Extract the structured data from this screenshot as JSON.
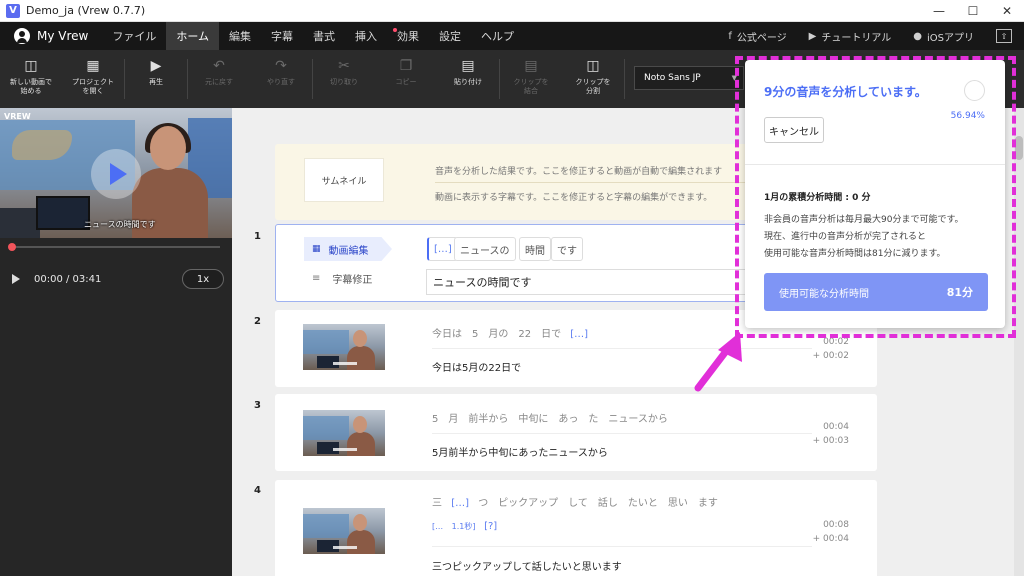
{
  "window": {
    "title": "Demo_ja (Vrew 0.7.7)",
    "logo": "V"
  },
  "menubar": {
    "user": "My Vrew",
    "items": [
      "ファイル",
      "ホーム",
      "編集",
      "字幕",
      "書式",
      "挿入",
      "効果",
      "設定",
      "ヘルプ"
    ],
    "active_index": 1,
    "links": [
      "公式ページ",
      "チュートリアル",
      "iOSアプリ"
    ]
  },
  "toolbar": {
    "tools": [
      {
        "label": "新しい動画で\n始める",
        "icon": "new-video-icon",
        "disabled": false
      },
      {
        "label": "プロジェクト\nを開く",
        "icon": "clapper-icon",
        "disabled": false
      },
      {
        "label": "再生",
        "icon": "play-icon",
        "disabled": false
      },
      {
        "label": "元に戻す",
        "icon": "undo-icon",
        "disabled": true
      },
      {
        "label": "やり直す",
        "icon": "redo-icon",
        "disabled": true
      },
      {
        "label": "切り取り",
        "icon": "scissors-icon",
        "disabled": true
      },
      {
        "label": "コピー",
        "icon": "copy-icon",
        "disabled": true
      },
      {
        "label": "貼り付け",
        "icon": "paste-icon",
        "disabled": false
      },
      {
        "label": "クリップを\n結合",
        "icon": "merge-icon",
        "disabled": true
      },
      {
        "label": "クリップを\n分割",
        "icon": "split-icon",
        "disabled": false
      }
    ],
    "font": "Noto Sans JP"
  },
  "player": {
    "caption": "ニュースの時間です",
    "time": "00:00 / 03:41",
    "speed": "1x",
    "corner": "VREW",
    "progress": 0
  },
  "thumbnail_card": {
    "button": "サムネイル",
    "text1": "音声を分析した結果です。ここを修正すると動画が自動で編集されます",
    "text2": "動画に表示する字幕です。ここを修正すると字幕の編集ができます。"
  },
  "clip1": {
    "number": "1",
    "video_tag": "動画編集",
    "subtitle_tag": "字幕修正",
    "words": [
      "[…]",
      "ニュースの",
      "時間",
      "です"
    ],
    "subtitle": "ニュースの時間です"
  },
  "clip2": {
    "number": "2",
    "words": "今日は　5　月の　22　日で",
    "bracket": "[…]",
    "subtitle": "今日は5月の22日で",
    "time": "00:02",
    "duration": "+ 00:02"
  },
  "clip3": {
    "number": "3",
    "words": "5　月　前半から　中旬に　あっ　た　ニュースから",
    "subtitle": "5月前半から中旬にあったニュースから",
    "time": "00:04",
    "duration": "+ 00:03"
  },
  "clip4": {
    "number": "4",
    "words_a": "三",
    "bracket": "[…]",
    "words_b": "つ　ピックアップ　して　話し　たいと　思い　ます",
    "pause": "[… 1.1秒]",
    "unknown": "[?]",
    "subtitle": "三つピックアップして話したいと思います",
    "time": "00:08",
    "duration": "+ 00:04"
  },
  "popup": {
    "title": "9分の音声を分析しています。",
    "percent": "56.94%",
    "cancel": "キャンセル",
    "month_usage": "1月の累積分析時間 : 0 分",
    "note": "非会員の音声分析は毎月最大90分まで可能です。\n現在、進行中の音声分析が完了されると\n使用可能な音声分析時間は81分に減ります。",
    "available_label": "使用可能な分析時間",
    "available_value": "81分"
  },
  "colors": {
    "accent": "#4c6ef5",
    "annotation": "#e12fd8",
    "record": "#f2545b"
  }
}
